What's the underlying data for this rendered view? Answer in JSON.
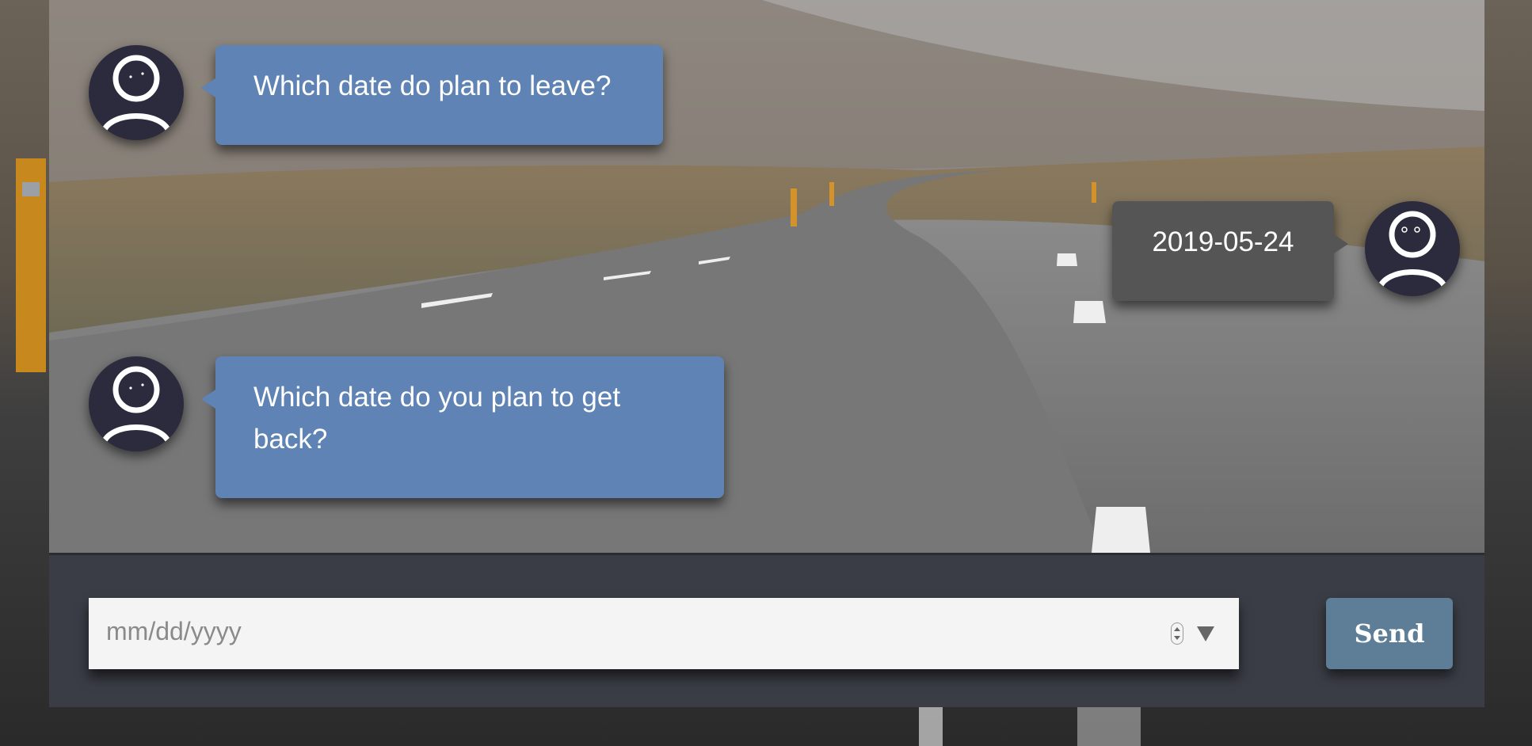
{
  "messages": [
    {
      "sender": "bot",
      "text": "Which date do plan to leave?"
    },
    {
      "sender": "user",
      "text": "2019-05-24"
    },
    {
      "sender": "bot",
      "text": "Which date do you plan to get back?"
    }
  ],
  "input": {
    "placeholder": "mm/dd/yyyy",
    "type": "date"
  },
  "send_button": {
    "label": "Send"
  },
  "icons": {
    "avatar": "user-avatar-icon",
    "spinner": "spinner-icon",
    "dropdown": "chevron-down-icon"
  },
  "colors": {
    "bot_bubble": "#5f83b4",
    "user_bubble": "#555555",
    "input_bar": "#3a3d45",
    "send_button": "#5d7e96",
    "avatar_bg": "#2c2b3e"
  }
}
